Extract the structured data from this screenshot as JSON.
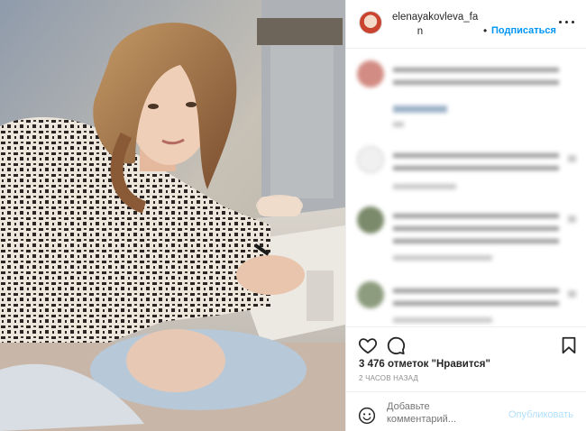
{
  "post": {
    "username": "elenayakovleva_fa",
    "username_tail": "n",
    "separator": "•",
    "follow_label": "Подписаться",
    "more_icon": "more-options-icon",
    "likes_text": "3 476 отметок \"Нравится\"",
    "time_text": "2 ЧАСОВ НАЗАД",
    "comment_placeholder": "Добавьте комментарий...",
    "publish_label": "Опубликовать"
  },
  "icons": {
    "like": "heart-icon",
    "comment": "comment-icon",
    "save": "bookmark-icon",
    "emoji": "emoji-icon"
  },
  "colors": {
    "accent": "#0095f6",
    "publish_disabled": "#b2dffc",
    "text": "#262626",
    "muted": "#8e8e8e"
  }
}
